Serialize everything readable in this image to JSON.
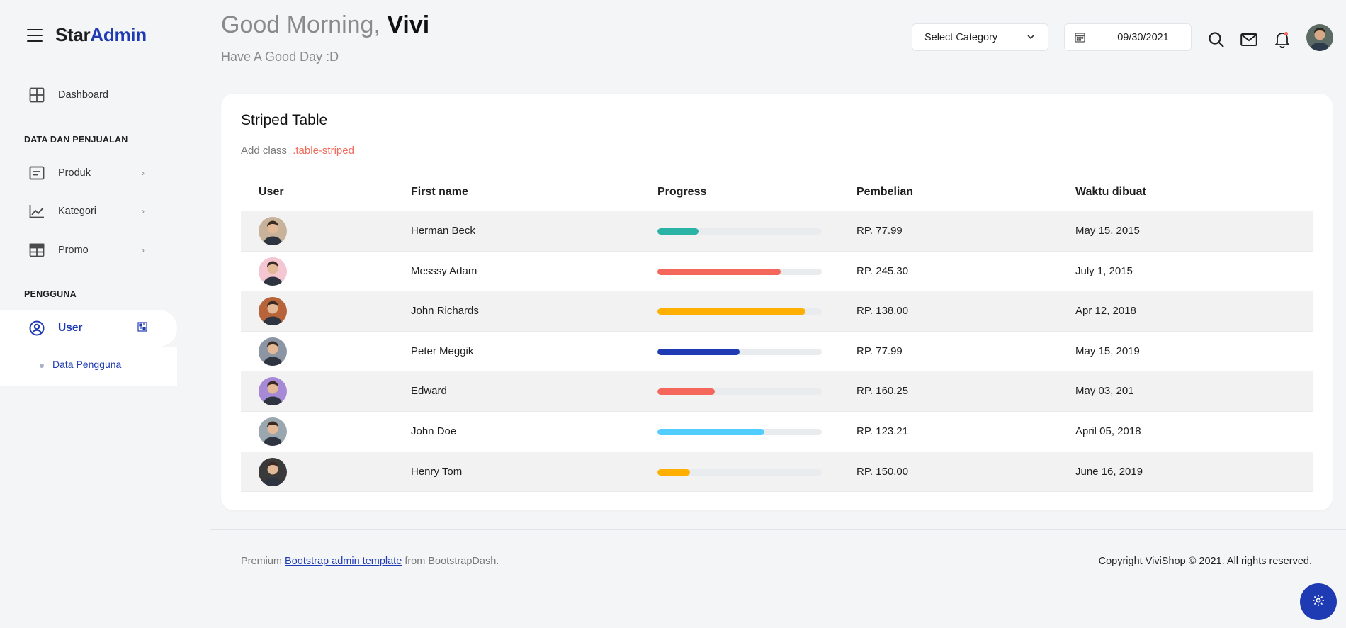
{
  "brand": {
    "part1": "Star",
    "part2": "Admin"
  },
  "sidebar": {
    "dashboard": {
      "label": "Dashboard",
      "icon": "grid-icon"
    },
    "section1": "DATA DAN PENJUALAN",
    "produk": {
      "label": "Produk",
      "chevron": "›",
      "icon": "list-icon"
    },
    "kategori": {
      "label": "Kategori",
      "chevron": "›",
      "icon": "chart-line-icon"
    },
    "promo": {
      "label": "Promo",
      "chevron": "›",
      "icon": "table-icon"
    },
    "section2": "PENGGUNA",
    "user": {
      "label": "User",
      "icon": "user-circle-icon"
    },
    "sub": {
      "label": "Data Pengguna"
    }
  },
  "header": {
    "greeting_prefix": "Good Morning,",
    "greeting_name": "Vivi",
    "subtitle": "Have A Good Day :D",
    "category_select": "Select Category",
    "date_value": "09/30/2021"
  },
  "card": {
    "title": "Striped Table",
    "desc_prefix": "Add class",
    "desc_code": ".table-striped"
  },
  "table": {
    "headers": [
      "User",
      "First name",
      "Progress",
      "Pembelian",
      "Waktu dibuat"
    ],
    "rows": [
      {
        "first": "Herman Beck",
        "progress": 0.25,
        "color": "#2bb3a6",
        "buy": "RP. 77.99",
        "time": "May 15, 2015",
        "avatar_bg": "#c9b29a"
      },
      {
        "first": "Messsy Adam",
        "progress": 0.75,
        "color": "#f5675a",
        "buy": "RP. 245.30",
        "time": "July 1, 2015",
        "avatar_bg": "#f3c6d2"
      },
      {
        "first": "John Richards",
        "progress": 0.9,
        "color": "#ffaf00",
        "buy": "RP. 138.00",
        "time": "Apr 12, 2018",
        "avatar_bg": "#b7643a"
      },
      {
        "first": "Peter Meggik",
        "progress": 0.5,
        "color": "#1f3bb3",
        "buy": "RP. 77.99",
        "time": "May 15, 2019",
        "avatar_bg": "#8c95a3"
      },
      {
        "first": "Edward",
        "progress": 0.35,
        "color": "#f5675a",
        "buy": "RP. 160.25",
        "time": "May 03, 201",
        "avatar_bg": "#a68ad6"
      },
      {
        "first": "John Doe",
        "progress": 0.65,
        "color": "#52cdff",
        "buy": "RP. 123.21",
        "time": "April 05, 2018",
        "avatar_bg": "#9aa7ae"
      },
      {
        "first": "Henry Tom",
        "progress": 0.2,
        "color": "#ffaf00",
        "buy": "RP. 150.00",
        "time": "June 16, 2019",
        "avatar_bg": "#3a3a3a"
      }
    ]
  },
  "footer": {
    "left_prefix": "Premium",
    "left_link": "Bootstrap admin template",
    "left_suffix": "from BootstrapDash.",
    "right": "Copyright ViviShop © 2021. All rights reserved."
  },
  "colors": {
    "primary": "#1f3bb3",
    "accent_code": "#f26b5b",
    "background": "#f4f5f7"
  }
}
